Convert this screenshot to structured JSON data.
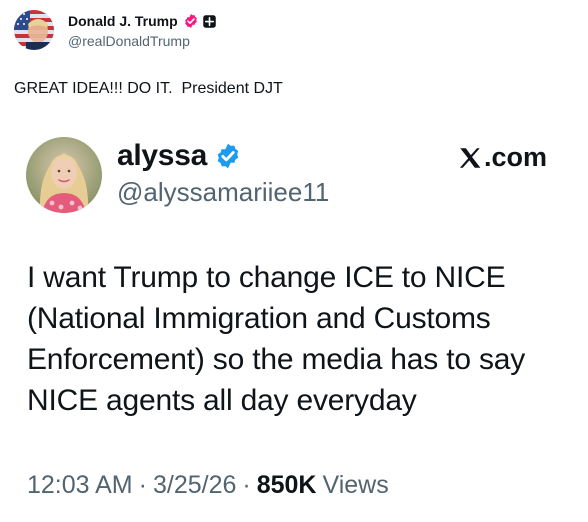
{
  "post": {
    "author_name": "Donald J. Trump",
    "author_handle": "@realDonaldTrump",
    "avatar_icon": "flag-portrait-avatar",
    "text": "GREAT IDEA!!! DO IT.  President DJT"
  },
  "quoted": {
    "name": "alyssa",
    "handle": "@alyssamariiee11",
    "site_label": ".com",
    "site_logo": "x-logo-icon",
    "body": "I want Trump to change ICE to NICE (National Immigration and Customs Enforcement) so the media has to say NICE agents all day everyday",
    "time": "12:03 AM",
    "date": "3/25/26",
    "views_count": "850K",
    "views_label": "Views"
  },
  "colors": {
    "text": "#0f1419",
    "secondary": "#536471",
    "verified_blue": "#1d9bf0",
    "affiliate_red": "#f91880"
  }
}
